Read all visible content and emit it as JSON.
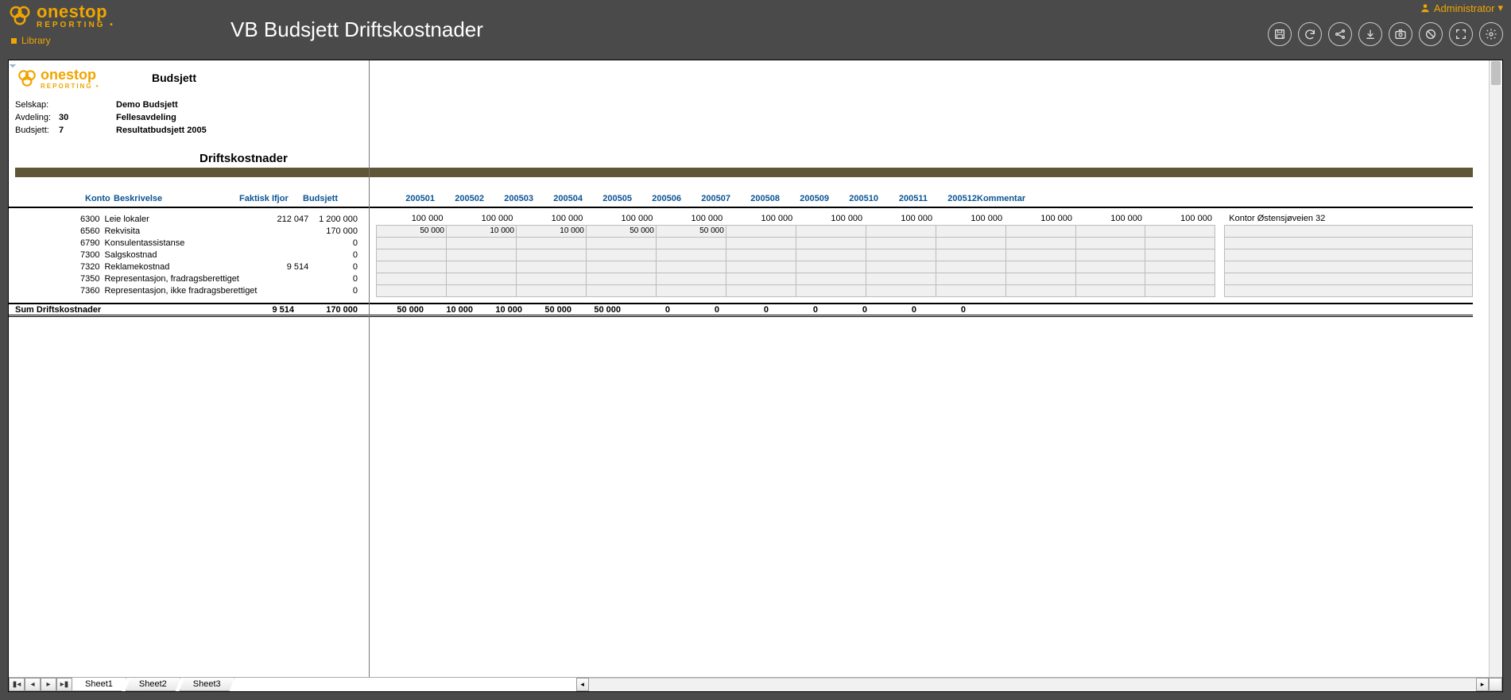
{
  "app": {
    "brand_main": "onestop",
    "brand_sub": "REPORTING",
    "library": "Library",
    "title": "VB Budsjett Driftskostnader",
    "user": "Administrator"
  },
  "report_header": {
    "logo_main": "onestop",
    "logo_sub": "REPORTING",
    "title": "Budsjett",
    "meta": {
      "selskap_label": "Selskap:",
      "selskap_value": "Demo Budsjett",
      "avdeling_label": "Avdeling:",
      "avdeling_code": "30",
      "avdeling_value": "Fellesavdeling",
      "budsjett_label": "Budsjett:",
      "budsjett_code": "7",
      "budsjett_value": "Resultatbudsjett 2005"
    },
    "section": "Driftskostnader"
  },
  "columns": {
    "konto": "Konto",
    "beskrivelse": "Beskrivelse",
    "faktisk": "Faktisk Ifjor",
    "budsjett": "Budsjett",
    "months": [
      "200501",
      "200502",
      "200503",
      "200504",
      "200505",
      "200506",
      "200507",
      "200508",
      "200509",
      "200510",
      "200511",
      "200512"
    ],
    "kommentar": "Kommentar"
  },
  "rows": [
    {
      "konto": "6300",
      "besk": "Leie lokaler",
      "faktisk": "212 047",
      "budsjett": "1 200 000",
      "m": [
        "100 000",
        "100 000",
        "100 000",
        "100 000",
        "100 000",
        "100 000",
        "100 000",
        "100 000",
        "100 000",
        "100 000",
        "100 000",
        "100 000"
      ],
      "editable": false,
      "kommentar": "Kontor Østensjøveien 32"
    },
    {
      "konto": "6560",
      "besk": "Rekvisita",
      "faktisk": "",
      "budsjett": "170 000",
      "m": [
        "50 000",
        "10 000",
        "10 000",
        "50 000",
        "50 000",
        "",
        "",
        "",
        "",
        "",
        "",
        ""
      ],
      "editable": true,
      "kommentar": ""
    },
    {
      "konto": "6790",
      "besk": "Konsulentassistanse",
      "faktisk": "",
      "budsjett": "0",
      "m": [
        "",
        "",
        "",
        "",
        "",
        "",
        "",
        "",
        "",
        "",
        "",
        ""
      ],
      "editable": true,
      "kommentar": ""
    },
    {
      "konto": "7300",
      "besk": "Salgskostnad",
      "faktisk": "",
      "budsjett": "0",
      "m": [
        "",
        "",
        "",
        "",
        "",
        "",
        "",
        "",
        "",
        "",
        "",
        ""
      ],
      "editable": true,
      "kommentar": ""
    },
    {
      "konto": "7320",
      "besk": "Reklamekostnad",
      "faktisk": "9 514",
      "budsjett": "0",
      "m": [
        "",
        "",
        "",
        "",
        "",
        "",
        "",
        "",
        "",
        "",
        "",
        ""
      ],
      "editable": true,
      "kommentar": ""
    },
    {
      "konto": "7350",
      "besk": "Representasjon, fradragsberettiget",
      "faktisk": "",
      "budsjett": "0",
      "m": [
        "",
        "",
        "",
        "",
        "",
        "",
        "",
        "",
        "",
        "",
        "",
        ""
      ],
      "editable": true,
      "kommentar": ""
    },
    {
      "konto": "7360",
      "besk": "Representasjon, ikke fradragsberettiget",
      "faktisk": "",
      "budsjett": "0",
      "m": [
        "",
        "",
        "",
        "",
        "",
        "",
        "",
        "",
        "",
        "",
        "",
        ""
      ],
      "editable": true,
      "kommentar": ""
    }
  ],
  "sum": {
    "label": "Sum Driftskostnader",
    "faktisk": "9 514",
    "budsjett": "170 000",
    "m": [
      "50 000",
      "10 000",
      "10 000",
      "50 000",
      "50 000",
      "0",
      "0",
      "0",
      "0",
      "0",
      "0",
      "0"
    ]
  },
  "tabs": [
    "Sheet1",
    "Sheet2",
    "Sheet3"
  ],
  "active_tab": 0
}
